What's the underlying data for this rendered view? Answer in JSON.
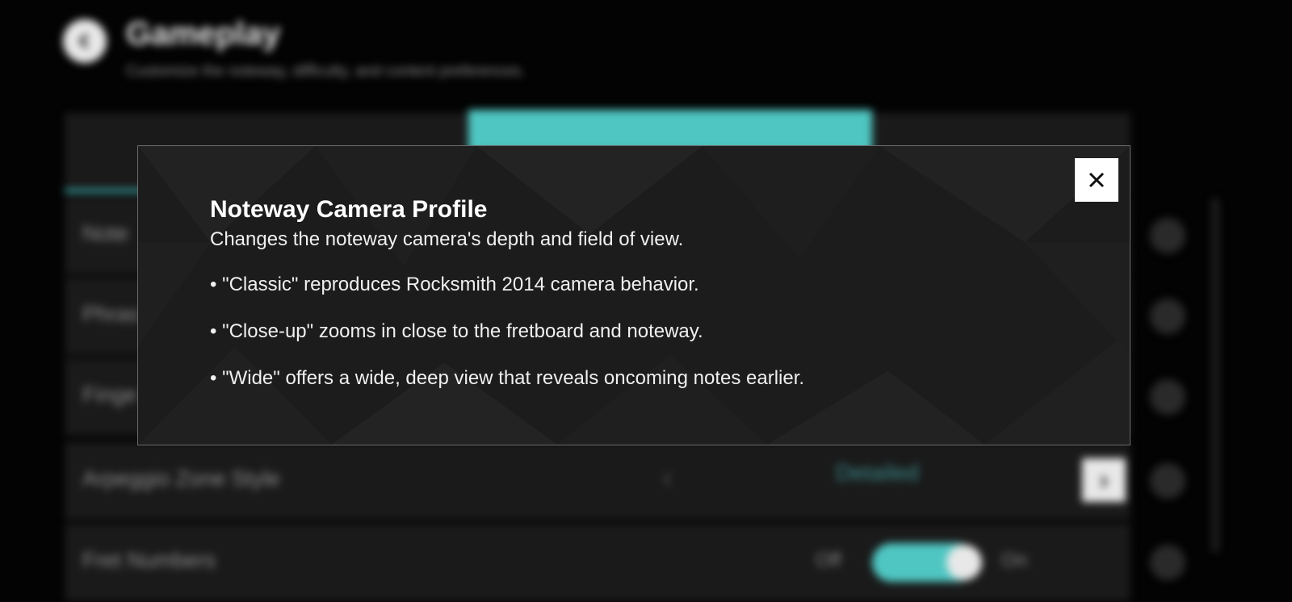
{
  "background": {
    "title": "Gameplay",
    "subtitle": "Customize the noteway, difficulty, and content preferences.",
    "rows": [
      {
        "label": "Note"
      },
      {
        "label": "Phras"
      },
      {
        "label": "Finge"
      },
      {
        "label": "Arpeggio Zone Style",
        "value": "Detailed"
      },
      {
        "label": "Fret Numbers",
        "off_label": "Off",
        "on_label": "On"
      }
    ]
  },
  "modal": {
    "title": "Noteway Camera Profile",
    "description": "Changes the noteway camera's depth and field of view.",
    "bullets": [
      "• \"Classic\" reproduces Rocksmith 2014 camera behavior.",
      "• \"Close-up\" zooms in close to the fretboard and noteway.",
      "• \"Wide\" offers a wide, deep view that reveals oncoming notes earlier."
    ]
  },
  "colors": {
    "accent": "#4fc6c2",
    "modal_bg": "#1c1c1c",
    "modal_border": "#6a6a6a"
  },
  "icons": {
    "back": "chevron-left-icon",
    "close": "close-icon"
  }
}
